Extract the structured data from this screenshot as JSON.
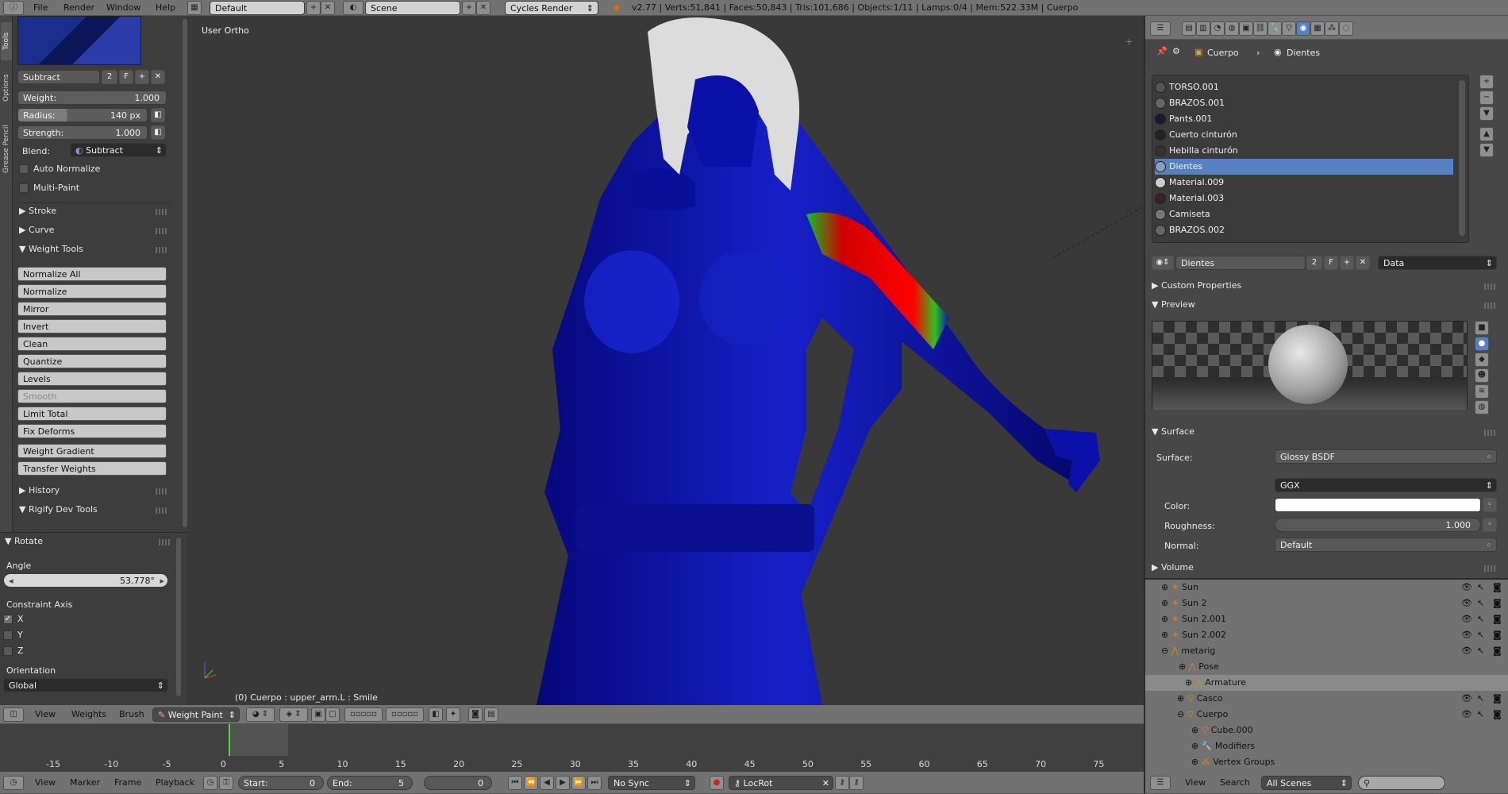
{
  "topbar": {
    "menus": [
      "File",
      "Render",
      "Window",
      "Help"
    ],
    "layout": "Default",
    "scene": "Scene",
    "engine": "Cycles Render",
    "stats": "v2.77 | Verts:51,841 | Faces:50,843 | Tris:101,686 | Objects:1/11 | Lamps:0/4 | Mem:522.33M | Cuerpo"
  },
  "left_tabs": [
    "Tools",
    "Options",
    "Grease Pencil"
  ],
  "brush": {
    "name": "Subtract",
    "users": "2",
    "fake": "F",
    "weight_label": "Weight:",
    "weight": "1.000",
    "radius_label": "Radius:",
    "radius": "140 px",
    "strength_label": "Strength:",
    "strength": "1.000",
    "blend_label": "Blend:",
    "blend": "Subtract",
    "auto_normalize": "Auto Normalize",
    "multi_paint": "Multi-Paint"
  },
  "panels": {
    "stroke": "Stroke",
    "curve": "Curve",
    "weight_tools": "Weight Tools",
    "history": "History",
    "rigify": "Rigify Dev Tools"
  },
  "weight_tools": [
    "Normalize All",
    "Normalize",
    "Mirror",
    "Invert",
    "Clean",
    "Quantize",
    "Levels",
    "Smooth",
    "Limit Total",
    "Fix Deforms",
    "Weight Gradient",
    "Transfer Weights"
  ],
  "operator": {
    "title": "Rotate",
    "angle_label": "Angle",
    "angle": "53.778°",
    "constraint_label": "Constraint Axis",
    "axes": [
      "X",
      "Y",
      "Z"
    ],
    "orientation_label": "Orientation",
    "orientation": "Global"
  },
  "viewport": {
    "view_label": "User Ortho",
    "status": "(0) Cuerpo : upper_arm.L : Smile"
  },
  "view_header": {
    "menus": [
      "View",
      "Weights",
      "Brush"
    ],
    "mode": "Weight Paint"
  },
  "timeline": {
    "ticks": [
      "-15",
      "-10",
      "-5",
      "0",
      "5",
      "10",
      "15",
      "20",
      "25",
      "30",
      "35",
      "40",
      "45",
      "50",
      "55",
      "60",
      "65",
      "70",
      "75"
    ],
    "menus": [
      "View",
      "Marker",
      "Frame",
      "Playback"
    ],
    "start_label": "Start:",
    "start": "0",
    "end_label": "End:",
    "end": "5",
    "current": "0",
    "sync": "No Sync",
    "keying": "LocRot"
  },
  "props": {
    "crumbs": [
      "Cuerpo",
      "Dientes"
    ],
    "materials": [
      "TORSO.001",
      "BRAZOS.001",
      "Pants.001",
      "Cuerto cinturón",
      "Hebilla cinturón",
      "Dientes",
      "Material.009",
      "Material.003",
      "Camiseta",
      "BRAZOS.002"
    ],
    "selected": "Dientes",
    "mat_name": "Dientes",
    "mat_users": "2",
    "mat_fake": "F",
    "link": "Data",
    "custom_props": "Custom Properties",
    "preview": "Preview",
    "surface_hdr": "Surface",
    "surface_label": "Surface:",
    "surface": "Glossy BSDF",
    "dist": "GGX",
    "color_label": "Color:",
    "rough_label": "Roughness:",
    "rough": "1.000",
    "normal_label": "Normal:",
    "normal": "Default",
    "volume": "Volume"
  },
  "outliner": {
    "items": [
      "Sun",
      "Sun 2",
      "Sun 2.001",
      "Sun 2.002",
      "metarig",
      "Pose",
      "Armature",
      "Casco",
      "Cuerpo",
      "Cube.000",
      "Modifiers",
      "Vertex Groups"
    ],
    "menus": [
      "View",
      "Search"
    ],
    "filter": "All Scenes"
  },
  "colors": {
    "header": "#727272",
    "panel": "#3d3d3d",
    "selected": "#5680c2",
    "mesh": "#0a10a8"
  }
}
